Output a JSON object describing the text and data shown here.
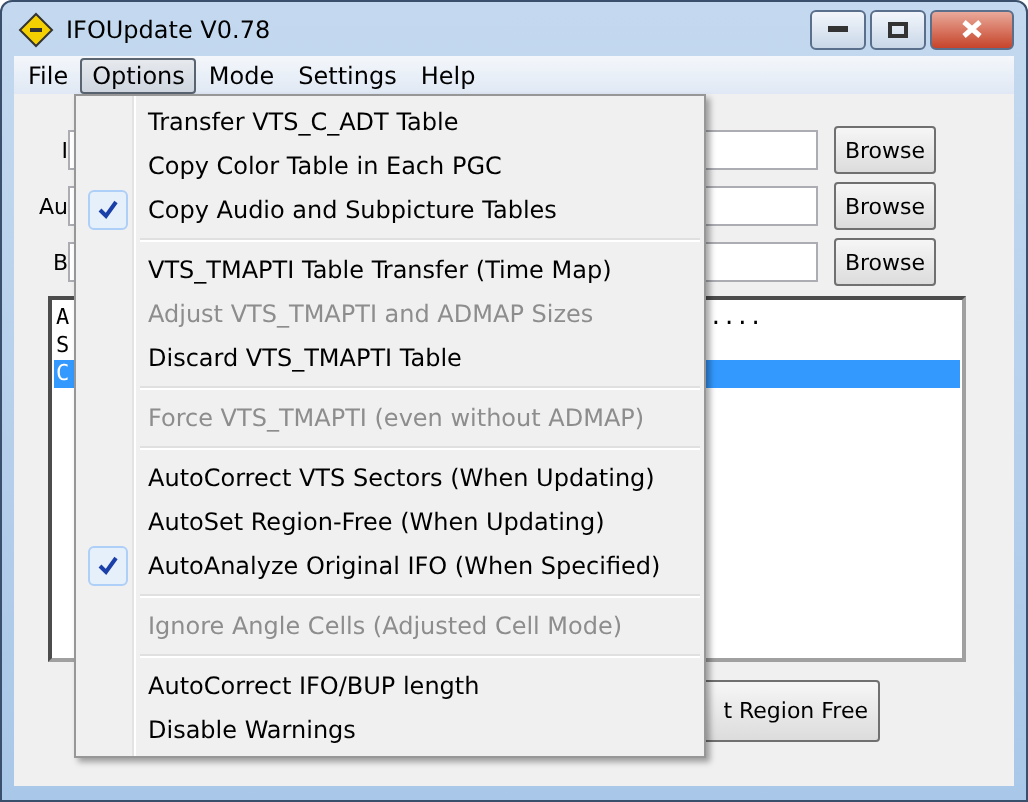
{
  "window": {
    "title": "IFOUpdate V0.78"
  },
  "menu_bar": [
    {
      "label": "File",
      "selected": false
    },
    {
      "label": "Options",
      "selected": true
    },
    {
      "label": "Mode",
      "selected": false
    },
    {
      "label": "Settings",
      "selected": false
    },
    {
      "label": "Help",
      "selected": false
    }
  ],
  "fields": [
    {
      "label": "I",
      "button": "Browse"
    },
    {
      "label": "Au",
      "button": "Browse"
    },
    {
      "label": "B",
      "button": "Browse"
    }
  ],
  "list": [
    {
      "text": "A",
      "tail": "....",
      "selected": false
    },
    {
      "text": "S",
      "selected": false
    },
    {
      "text": "C",
      "selected": true
    }
  ],
  "action_button": "t Region Free",
  "options_menu": [
    {
      "kind": "item",
      "label": "Transfer VTS_C_ADT Table",
      "checked": false,
      "disabled": false
    },
    {
      "kind": "item",
      "label": "Copy Color Table in Each PGC",
      "checked": false,
      "disabled": false
    },
    {
      "kind": "item",
      "label": "Copy Audio and Subpicture Tables",
      "checked": true,
      "disabled": false
    },
    {
      "kind": "separator"
    },
    {
      "kind": "item",
      "label": "VTS_TMAPTI Table Transfer (Time Map)",
      "checked": false,
      "disabled": false
    },
    {
      "kind": "item",
      "label": "Adjust VTS_TMAPTI and ADMAP Sizes",
      "checked": false,
      "disabled": true
    },
    {
      "kind": "item",
      "label": "Discard VTS_TMAPTI Table",
      "checked": false,
      "disabled": false
    },
    {
      "kind": "separator"
    },
    {
      "kind": "item",
      "label": "Force VTS_TMAPTI (even without ADMAP)",
      "checked": false,
      "disabled": true
    },
    {
      "kind": "separator"
    },
    {
      "kind": "item",
      "label": "AutoCorrect VTS Sectors (When Updating)",
      "checked": false,
      "disabled": false
    },
    {
      "kind": "item",
      "label": "AutoSet Region-Free (When Updating)",
      "checked": false,
      "disabled": false
    },
    {
      "kind": "item",
      "label": "AutoAnalyze Original IFO (When Specified)",
      "checked": true,
      "disabled": false
    },
    {
      "kind": "separator"
    },
    {
      "kind": "item",
      "label": "Ignore Angle Cells  (Adjusted Cell Mode)",
      "checked": false,
      "disabled": true
    },
    {
      "kind": "separator"
    },
    {
      "kind": "item",
      "label": "AutoCorrect IFO/BUP length",
      "checked": false,
      "disabled": false
    },
    {
      "kind": "item",
      "label": "Disable Warnings",
      "checked": false,
      "disabled": false
    }
  ]
}
